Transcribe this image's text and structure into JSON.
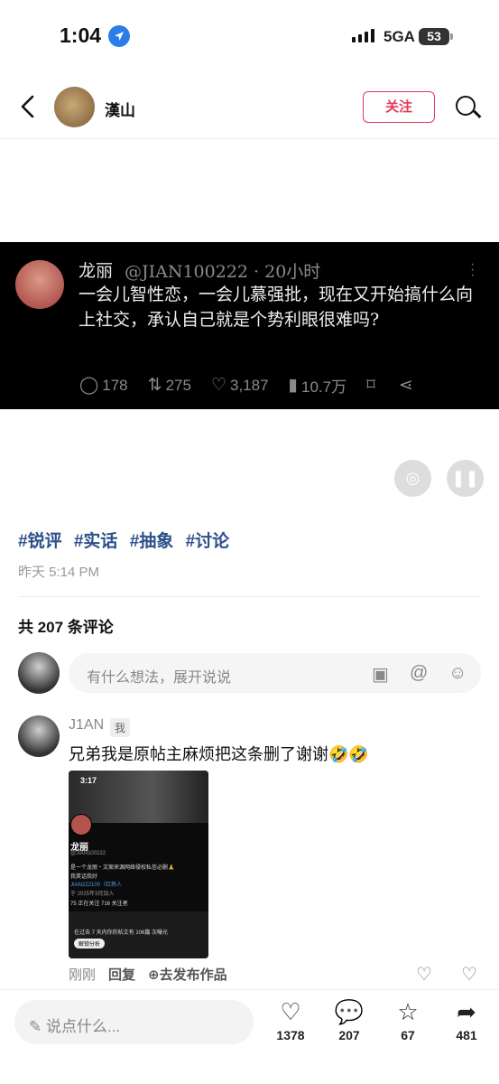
{
  "status_bar": {
    "time": "1:04",
    "network": "5GA",
    "battery": "53"
  },
  "nav": {
    "username": "漢山",
    "follow_label": "关注"
  },
  "tweet": {
    "name": "龙丽",
    "handle_time": "@JIAN100222 · 20小时",
    "text": "一会儿智性恋，一会儿慕强批，现在又开始搞什么向上社交，承认自己就是个势利眼很难吗?",
    "replies": "178",
    "retweets": "275",
    "likes": "3,187",
    "views": "10.7万"
  },
  "tags": [
    "#锐评",
    "#实话",
    "#抽象",
    "#讨论"
  ],
  "post_time": "昨天 5:14 PM",
  "comment_count_text": "共 207 条评论",
  "comment_input_placeholder": "有什么想法，展开说说",
  "comment": {
    "author": "J1AN",
    "badge": "我",
    "text": "兄弟我是原帖主麻烦把这条删了谢谢🤣🤣",
    "image": {
      "time": "3:17",
      "name": "龙丽",
      "handle": "@JIAN100222",
      "line1": "是一个龙丽・文案来源网络侵权私信必删🙏",
      "line2": "我笑话我好",
      "line3": "JIAN222100（红熟人",
      "line4": "于 2025年3月加入",
      "line5": "75 正在关注  716 关注者",
      "line6": "在过去 7 天内你的帖文有 106篇 次曝光",
      "button": "解锁分析"
    },
    "time": "刚刚",
    "reply_label": "回复",
    "publish_label": "去发布作品"
  },
  "bottom_bar": {
    "say_placeholder": "说点什么...",
    "likes": "1378",
    "comments": "207",
    "favorites": "67",
    "shares": "481"
  }
}
